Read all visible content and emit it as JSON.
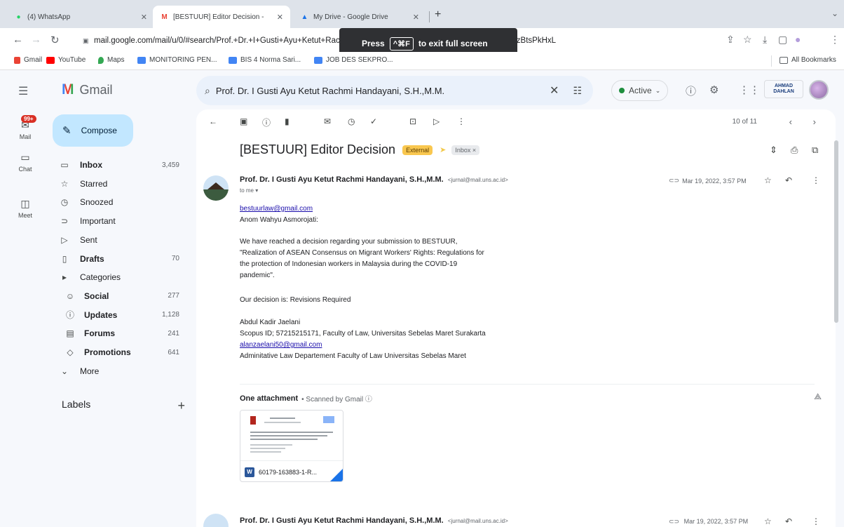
{
  "browser": {
    "tabs": [
      {
        "title": "(4) WhatsApp",
        "icon": "whatsapp-icon",
        "color": "#25d366"
      },
      {
        "title": "[BESTUUR] Editor Decision - ",
        "icon": "gmail-icon",
        "color": "#ea4335"
      },
      {
        "title": "My Drive - Google Drive",
        "icon": "drive-icon",
        "color": "#1a73e8"
      }
    ],
    "url": "mail.google.com/mail/u/0/#search/Prof.+Dr.+I+Gusti+Ayu+Ketut+Rachmi+Handayani...FMfcgzGmvTzfCkPDPXZMNWtzBtsPkHxL",
    "fullscreen_popup": {
      "press": "Press",
      "key": "^⌘F",
      "message": "to exit full screen"
    },
    "bookmarks": [
      {
        "label": "Gmail",
        "color": "#ea4335"
      },
      {
        "label": "YouTube",
        "color": "#ff0000"
      },
      {
        "label": "Maps",
        "color": "#34a853"
      },
      {
        "label": "MONITORING PEN...",
        "color": "#4285f4"
      },
      {
        "label": "BIS 4 Norma Sari...",
        "color": "#4285f4"
      },
      {
        "label": "JOB DES SEKPRO...",
        "color": "#4285f4"
      }
    ],
    "all_bookmarks": "All Bookmarks"
  },
  "gmail": {
    "logo_text": "Gmail",
    "search_value": "Prof. Dr. I Gusti Ayu Ketut Rachmi Handayani, S.H.,M.M.",
    "status": "Active",
    "org_logo_text": "AHMAD DAHLAN",
    "rail": [
      {
        "label": "Mail",
        "badge": "99+"
      },
      {
        "label": "Chat"
      },
      {
        "label": "Meet"
      }
    ],
    "compose": "Compose",
    "nav": [
      {
        "label": "Inbox",
        "count": "3,459",
        "icon": "inbox-icon",
        "glyph": "▭",
        "bold": true,
        "sub": false
      },
      {
        "label": "Starred",
        "count": "",
        "icon": "star-icon",
        "glyph": "☆",
        "bold": false,
        "sub": false
      },
      {
        "label": "Snoozed",
        "count": "",
        "icon": "clock-icon",
        "glyph": "◷",
        "bold": false,
        "sub": false
      },
      {
        "label": "Important",
        "count": "",
        "icon": "important-icon",
        "glyph": "⊃",
        "bold": false,
        "sub": false
      },
      {
        "label": "Sent",
        "count": "",
        "icon": "send-icon",
        "glyph": "▷",
        "bold": false,
        "sub": false
      },
      {
        "label": "Drafts",
        "count": "70",
        "icon": "draft-icon",
        "glyph": "▯",
        "bold": true,
        "sub": false
      },
      {
        "label": "Categories",
        "count": "",
        "icon": "label-icon",
        "glyph": "▸",
        "bold": false,
        "sub": false
      },
      {
        "label": "Social",
        "count": "277",
        "icon": "people-icon",
        "glyph": "☺",
        "bold": true,
        "sub": true
      },
      {
        "label": "Updates",
        "count": "1,128",
        "icon": "info-icon",
        "glyph": "ⓘ",
        "bold": true,
        "sub": true
      },
      {
        "label": "Forums",
        "count": "241",
        "icon": "forum-icon",
        "glyph": "▤",
        "bold": true,
        "sub": true
      },
      {
        "label": "Promotions",
        "count": "641",
        "icon": "tag-icon",
        "glyph": "◇",
        "bold": true,
        "sub": true
      },
      {
        "label": "More",
        "count": "",
        "icon": "chevron-down-icon",
        "glyph": "⌄",
        "bold": false,
        "sub": false
      }
    ],
    "labels_heading": "Labels",
    "pager": "10 of 11",
    "email": {
      "subject": "[BESTUUR] Editor Decision",
      "tag_external": "External",
      "tag_inbox": "Inbox ×",
      "sender": "Prof. Dr. I Gusti Ayu Ketut Rachmi Handayani, S.H.,M.M.",
      "sender_email": "<jurnal@mail.uns.ac.id>",
      "to": "to me ▾",
      "date": "Mar 19, 2022, 3:57 PM",
      "body": {
        "link1": "bestuurlaw@gmail.com",
        "greeting": "Anom Wahyu Asmorojati:",
        "p1_line1": "We have reached a decision regarding your submission to BESTUUR,",
        "p1_line2": "\"Realization of ASEAN Consensus on Migrant Workers' Rights: Regulations for",
        "p1_line3": "the protection of Indonesian workers in Malaysia during the COVID-19",
        "p1_line4": "pandemic\".",
        "decision": "Our decision is: Revisions Required",
        "sig_name": "Abdul Kadir Jaelani",
        "sig_scopus": "Scopus ID; 57215215171, Faculty of Law, Universitas Sebelas Maret Surakarta",
        "sig_email": "alanzaelani50@gmail.com",
        "sig_dept": "Adminitative Law Departement Faculty of Law Universitas Sebelas Maret"
      },
      "attachment_heading": "One attachment",
      "attachment_scan": "• Scanned by Gmail ⓘ",
      "attachment_name": "60179-163883-1-R..."
    },
    "email2": {
      "sender": "Prof. Dr. I Gusti Ayu Ketut Rachmi Handayani, S.H.,M.M.",
      "sender_email": "<jurnal@mail.uns.ac.id>",
      "date": "Mar 19, 2022, 3:57 PM"
    }
  }
}
